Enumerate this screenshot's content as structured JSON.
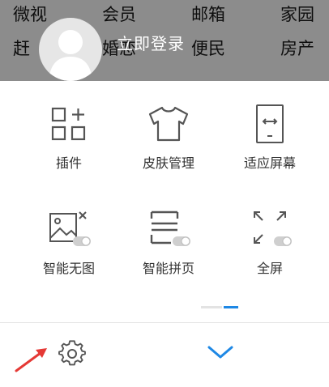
{
  "background_nav": {
    "row1": [
      "微视",
      "会员",
      "邮箱",
      "家园"
    ],
    "row2": [
      "赶",
      "婚恋",
      "便民",
      "房产"
    ]
  },
  "header": {
    "login_text": "立即登录"
  },
  "menu_items": [
    {
      "label": "插件",
      "icon": "plugin-icon"
    },
    {
      "label": "皮肤管理",
      "icon": "tshirt-icon"
    },
    {
      "label": "适应屏幕",
      "icon": "fit-screen-icon"
    },
    {
      "label": "智能无图",
      "icon": "no-image-icon"
    },
    {
      "label": "智能拼页",
      "icon": "page-merge-icon"
    },
    {
      "label": "全屏",
      "icon": "fullscreen-icon"
    }
  ],
  "bottom_bar": {
    "settings_icon": "gear-icon",
    "collapse_icon": "chevron-down-icon"
  },
  "colors": {
    "accent": "#1e88e5",
    "icon_gray": "#555555",
    "annotation_red": "#e53935"
  }
}
